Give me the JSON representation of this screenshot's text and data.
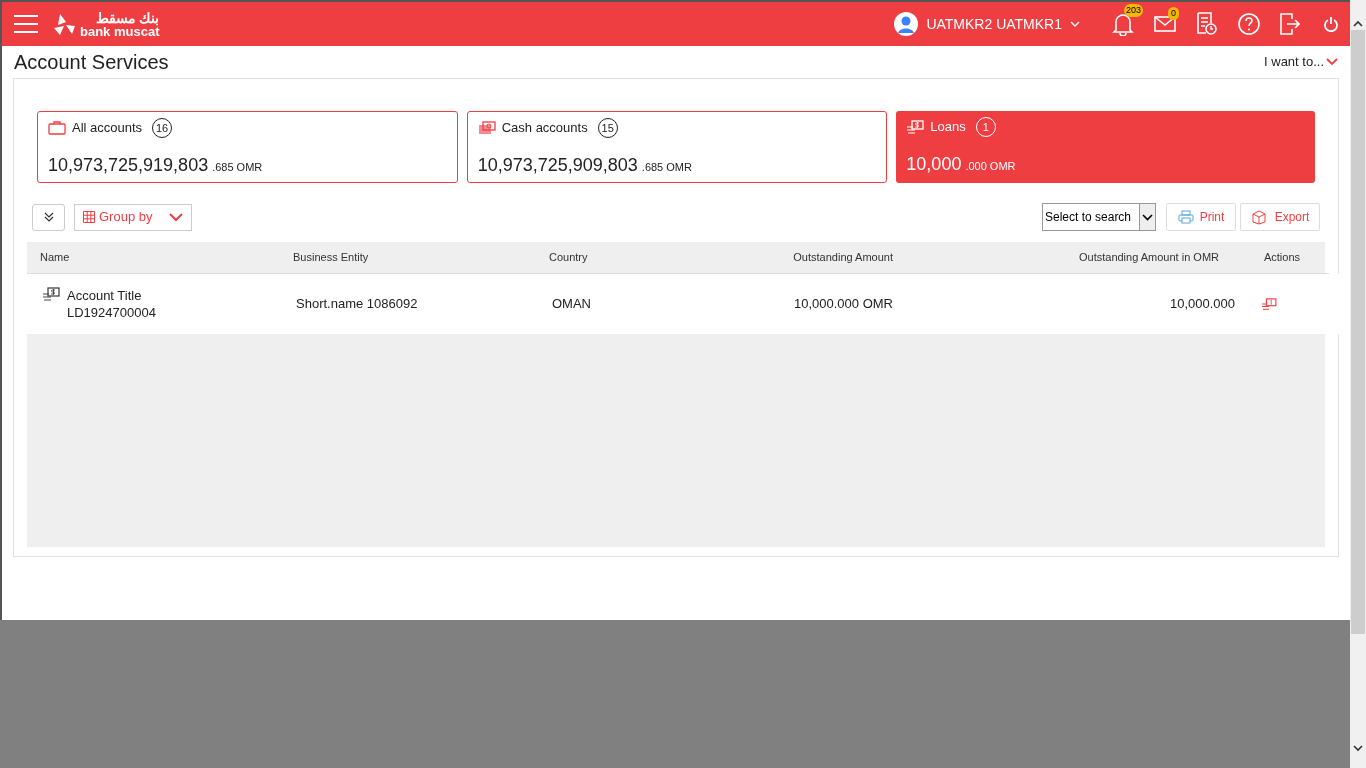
{
  "header": {
    "logo_arabic": "بنك مسقط",
    "logo_text": "bank muscat",
    "user": "UATMKR2 UATMKR1",
    "notifications": "203",
    "messages": "0"
  },
  "page": {
    "title": "Account Services",
    "menu": "I want to..."
  },
  "cards": [
    {
      "kind": "wallet",
      "label": "All accounts",
      "count": "16",
      "amount": "10,973,725,919,803",
      "decimals": ".685 OMR",
      "selected": false
    },
    {
      "kind": "cash",
      "label": "Cash accounts",
      "count": "15",
      "amount": "10,973,725,909,803",
      "decimals": ".685 OMR",
      "selected": false
    },
    {
      "kind": "loan",
      "label": "Loans",
      "count": "1",
      "amount": "10,000",
      "decimals": ".000 OMR",
      "selected": true
    }
  ],
  "toolbar": {
    "group_by": "Group by",
    "search": "Select to search",
    "print": "Print",
    "export": "Export"
  },
  "table": {
    "columns": [
      "Name",
      "Business Entity",
      "Country",
      "Outstanding Amount",
      "Outstanding Amount in OMR",
      "Actions"
    ],
    "rows": [
      {
        "title": "Account Title",
        "number": "LD1924700004",
        "entity": "Short.name 1086092",
        "country": "OMAN",
        "amount": "10,000.000 OMR",
        "amount_omr": "10,000.000"
      }
    ]
  }
}
